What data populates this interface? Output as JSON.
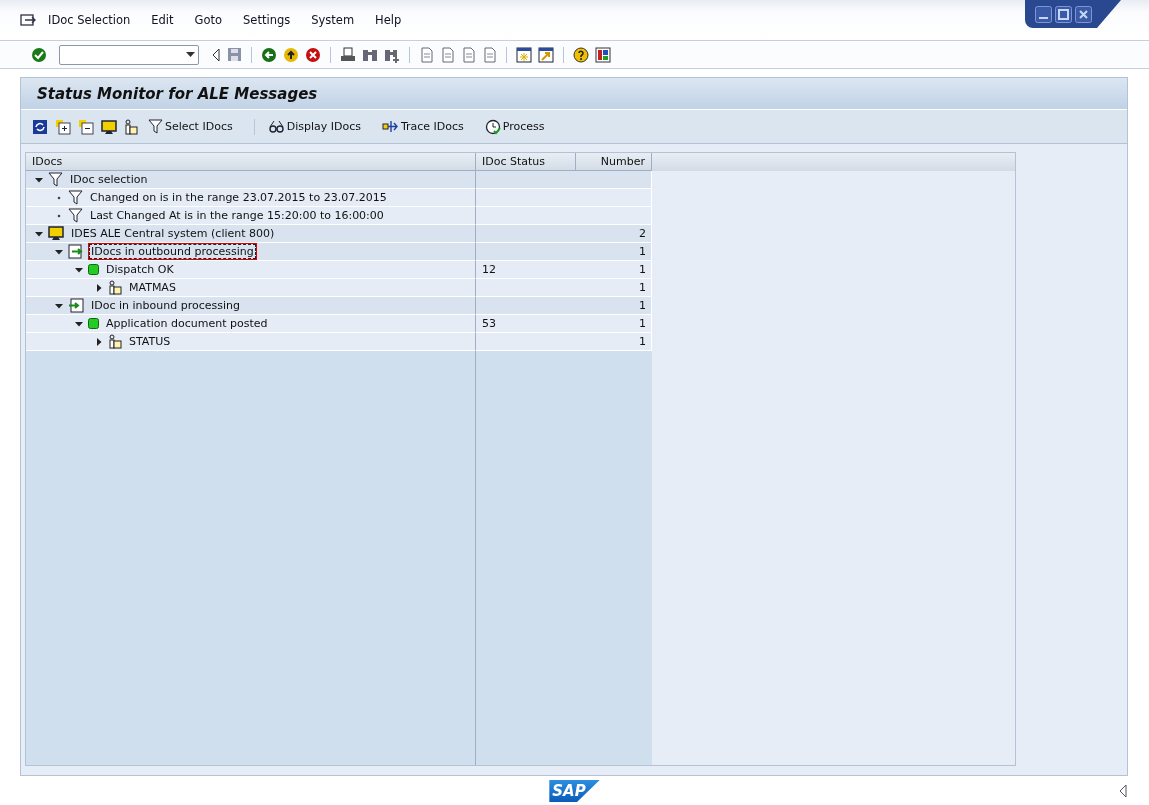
{
  "menu": [
    "IDoc Selection",
    "Edit",
    "Goto",
    "Settings",
    "System",
    "Help"
  ],
  "screen_title": "Status Monitor for ALE Messages",
  "app_toolbar": [
    "Select IDocs",
    "Display IDocs",
    "Trace IDocs",
    "Process"
  ],
  "tree": {
    "columns": [
      "IDocs",
      "IDoc Status",
      "Number"
    ],
    "rows": [
      {
        "label": "IDoc selection",
        "kind": "filter",
        "expanded": true,
        "selected": false,
        "children": [
          {
            "label": "Changed on is in the range 23.07.2015 to 23.07.2015",
            "kind": "filter",
            "selected": false
          },
          {
            "label": "Last Changed At is in the range 15:20:00 to 16:00:00",
            "kind": "filter",
            "selected": false
          }
        ]
      },
      {
        "label": "IDES ALE Central system (client 800)",
        "kind": "system",
        "expanded": true,
        "selected": false,
        "number": "2",
        "children": [
          {
            "label": "IDocs in outbound processing",
            "kind": "outbound",
            "expanded": true,
            "selected": true,
            "number": "1",
            "children": [
              {
                "label": "Dispatch OK",
                "kind": "status",
                "expanded": true,
                "selected": false,
                "status": "12",
                "number": "1",
                "children": [
                  {
                    "label": "MATMAS",
                    "kind": "object",
                    "expanded": false,
                    "selected": false,
                    "number": "1"
                  }
                ]
              }
            ]
          },
          {
            "label": "IDoc in inbound processing",
            "kind": "inbound",
            "expanded": true,
            "selected": false,
            "number": "1",
            "children": [
              {
                "label": "Application document posted",
                "kind": "status",
                "expanded": true,
                "selected": false,
                "status": "53",
                "number": "1",
                "children": [
                  {
                    "label": "STATUS",
                    "kind": "object",
                    "expanded": false,
                    "selected": false,
                    "number": "1"
                  }
                ]
              }
            ]
          }
        ]
      }
    ]
  },
  "logo": "SAP"
}
